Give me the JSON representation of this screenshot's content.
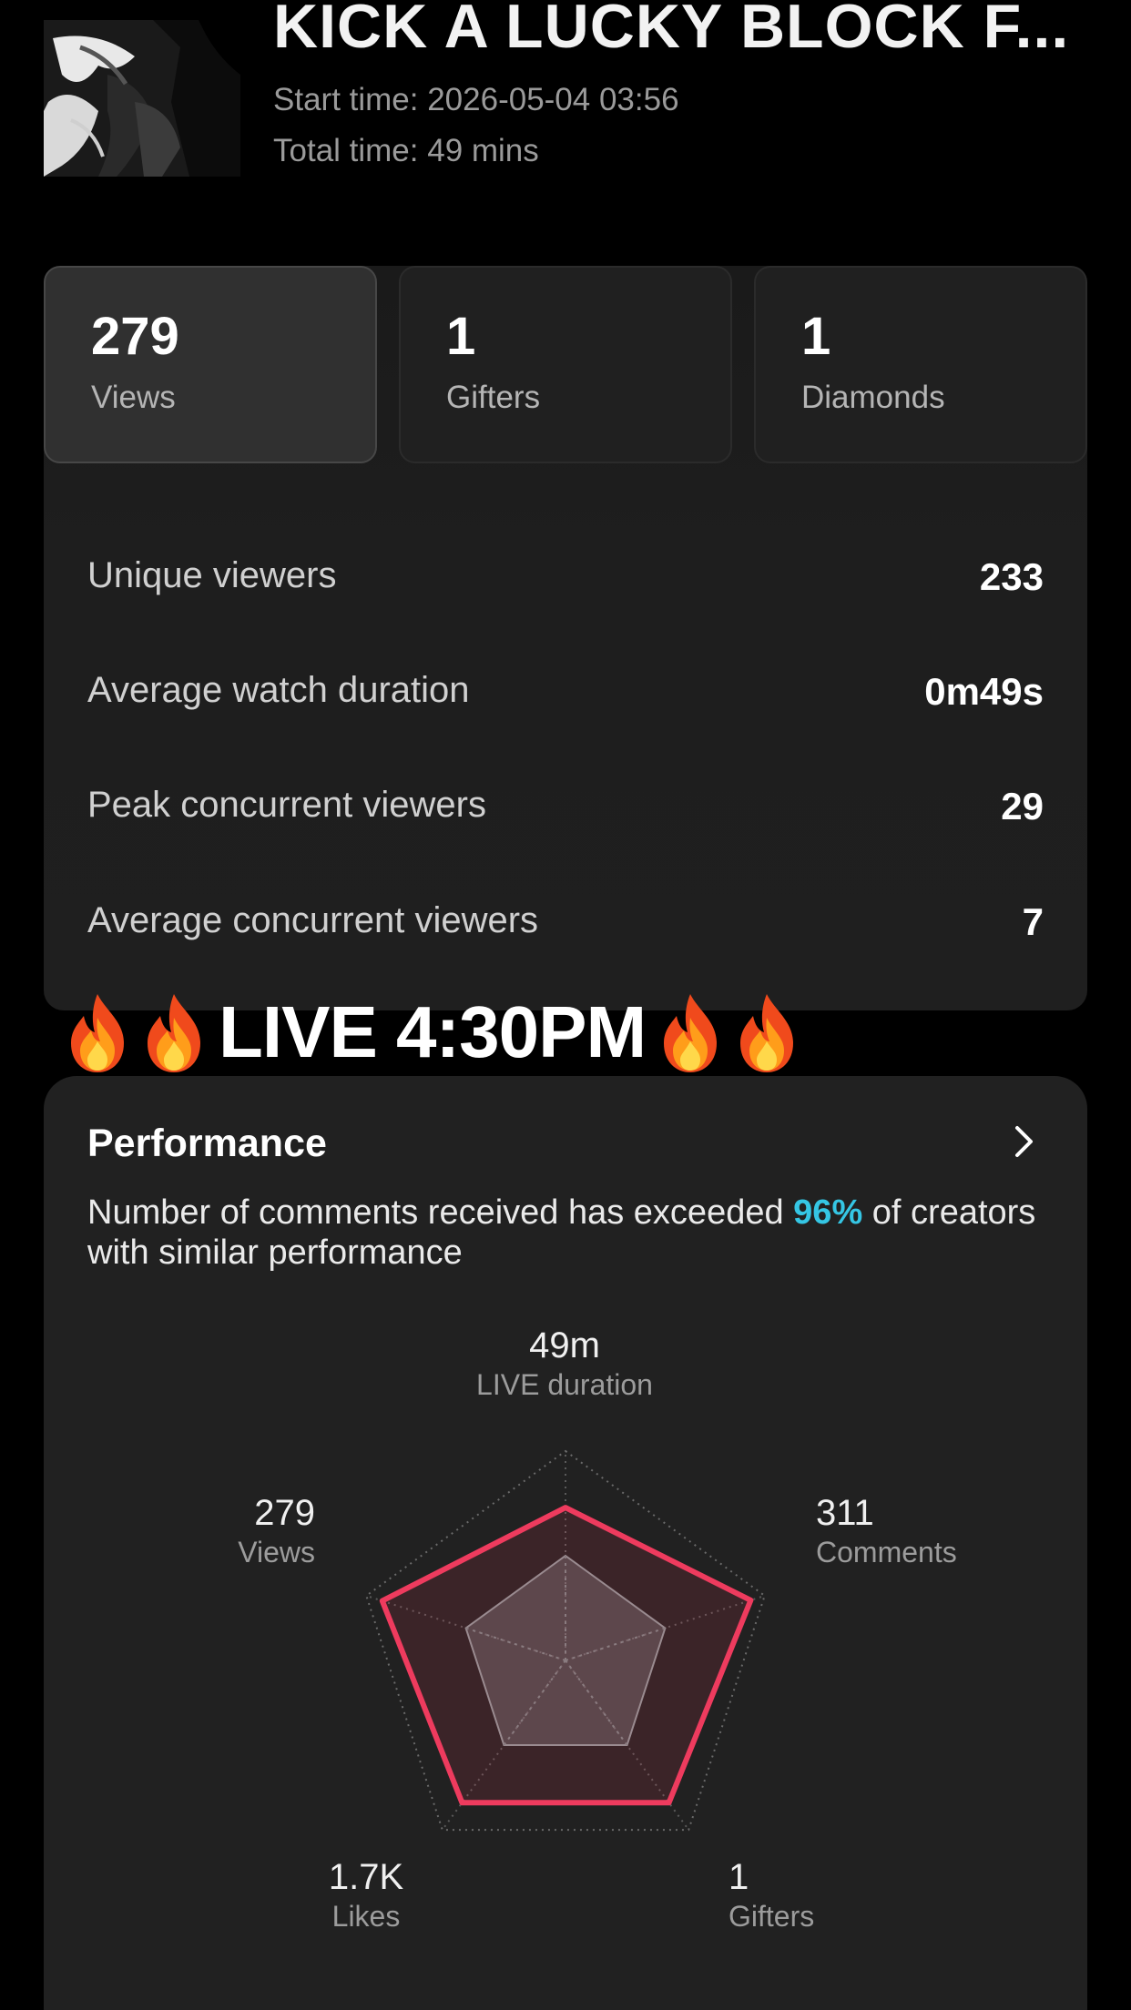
{
  "header": {
    "title": "KICK A LUCKY BLOCK F...",
    "start_time": "Start time: 2026-05-04 03:56",
    "total_time": "Total time: 49 mins"
  },
  "tiles": [
    {
      "value": "279",
      "label": "Views",
      "selected": true
    },
    {
      "value": "1",
      "label": "Gifters",
      "selected": false
    },
    {
      "value": "1",
      "label": "Diamonds",
      "selected": false
    }
  ],
  "metrics": [
    {
      "label": "Unique viewers",
      "value": "233"
    },
    {
      "label": "Average watch duration",
      "value": "0m49s"
    },
    {
      "label": "Peak concurrent viewers",
      "value": "29"
    },
    {
      "label": "Average concurrent viewers",
      "value": "7"
    }
  ],
  "banner": {
    "text": "LIVE 4:30PM",
    "icon": "fire-icon"
  },
  "performance": {
    "title": "Performance",
    "desc_before": "Number of comments received has exceeded ",
    "desc_highlight": "96%",
    "desc_after": " of creators with similar performance",
    "highlight_color": "#35c6e4",
    "radar": {
      "axes": [
        {
          "value": "49m",
          "label": "LIVE duration"
        },
        {
          "value": "311",
          "label": "Comments"
        },
        {
          "value": "1",
          "label": "Gifters"
        },
        {
          "value": "1.7K",
          "label": "Likes"
        },
        {
          "value": "279",
          "label": "Views"
        }
      ],
      "creator_levels": [
        0.73,
        0.93,
        0.84,
        0.84,
        0.92
      ],
      "similar_levels": [
        0.5,
        0.5,
        0.5,
        0.5,
        0.5
      ],
      "creator_color": "#ee3b5e",
      "similar_color": "#6e5a5e"
    }
  }
}
